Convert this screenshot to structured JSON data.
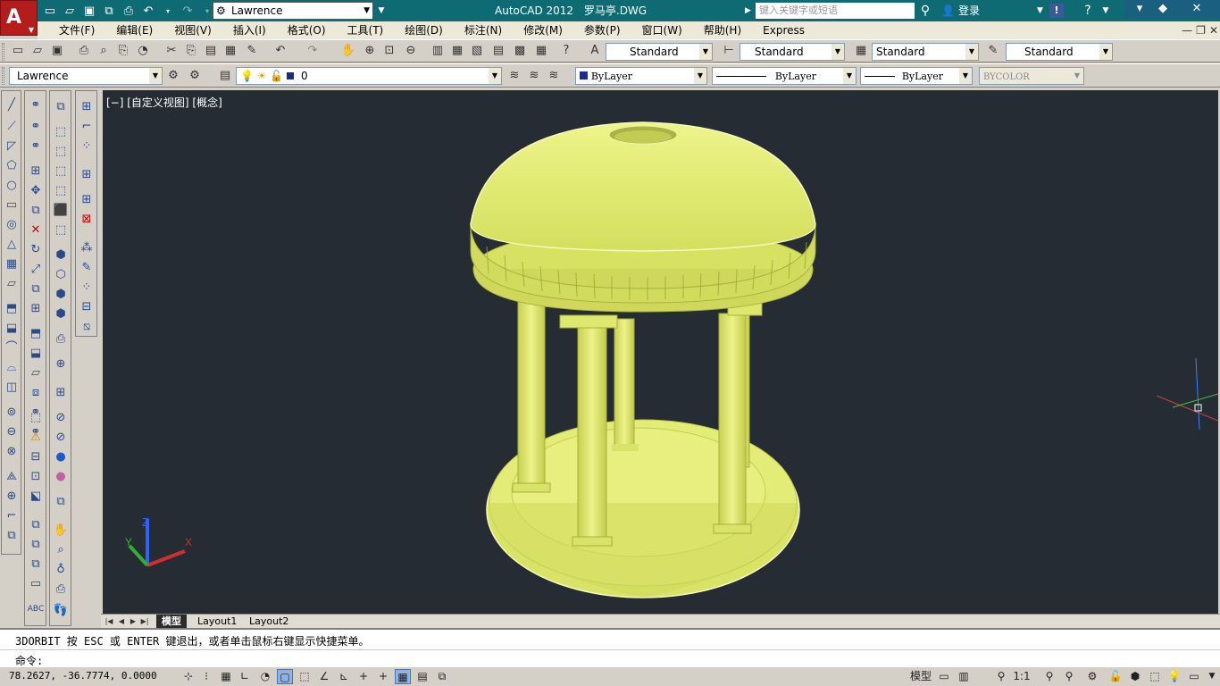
{
  "titlebar": {
    "app_name": "AutoCAD 2012",
    "file_name": "罗马亭.DWG",
    "workspace": "Lawrence",
    "search_placeholder": "键入关键字或短语",
    "signin_label": "登录",
    "icons": [
      "new-icon",
      "open-icon",
      "save-icon",
      "saveas-icon",
      "print-icon",
      "undo-icon",
      "redo-icon"
    ]
  },
  "menubar": {
    "items": [
      "文件(F)",
      "编辑(E)",
      "视图(V)",
      "插入(I)",
      "格式(O)",
      "工具(T)",
      "绘图(D)",
      "标注(N)",
      "修改(M)",
      "参数(P)",
      "窗口(W)",
      "帮助(H)",
      "Express"
    ]
  },
  "styles": {
    "text_style": "Standard",
    "dim_style": "Standard",
    "table_style": "Standard",
    "multileader_style": "Standard"
  },
  "layers": {
    "workspace": "Lawrence",
    "current_layer": "0",
    "color": "ByLayer",
    "linetype": "ByLayer",
    "lineweight": "ByLayer",
    "plotstyle": "BYCOLOR"
  },
  "viewport": {
    "label": "[−] [自定义视图] [概念]",
    "model_color": "#dde873",
    "bg_color": "#252c33"
  },
  "tabs": [
    "模型",
    "Layout1",
    "Layout2"
  ],
  "command": {
    "history": "3DORBIT 按 ESC 或 ENTER 键退出，或者单击鼠标右键显示快捷菜单。",
    "prompt": "命令:"
  },
  "status": {
    "coords": "78.2627,  -36.7774, 0.0000",
    "space": "模型",
    "annotation_scale": "1:1"
  }
}
